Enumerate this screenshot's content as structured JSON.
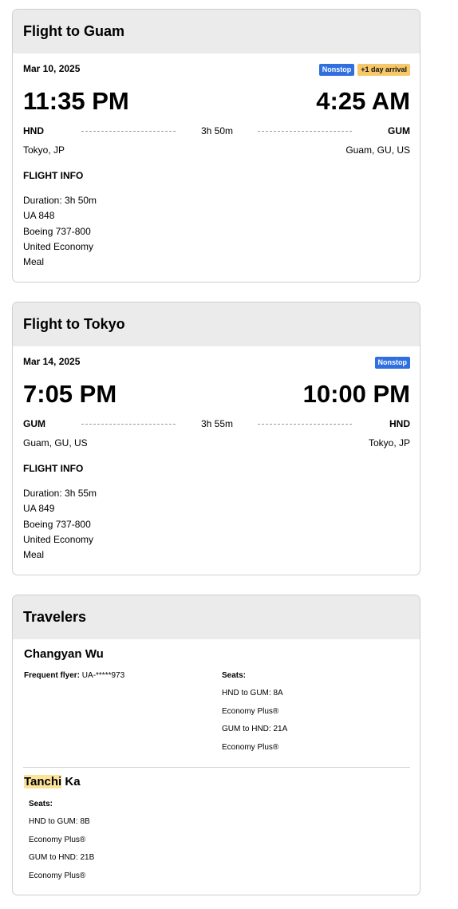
{
  "flights": [
    {
      "title": "Flight to Guam",
      "date": "Mar 10, 2025",
      "badges": [
        "Nonstop",
        "+1 day arrival"
      ],
      "depart_time": "11:35 PM",
      "arrive_time": "4:25 AM",
      "from_code": "HND",
      "to_code": "GUM",
      "duration": "3h 50m",
      "from_city": "Tokyo, JP",
      "to_city": "Guam, GU, US",
      "info_title": "FLIGHT INFO",
      "info": [
        "Duration: 3h 50m",
        "UA 848",
        "Boeing 737-800",
        "United Economy",
        "Meal"
      ]
    },
    {
      "title": "Flight to Tokyo",
      "date": "Mar 14, 2025",
      "badges": [
        "Nonstop"
      ],
      "depart_time": "7:05 PM",
      "arrive_time": "10:00 PM",
      "from_code": "GUM",
      "to_code": "HND",
      "duration": "3h 55m",
      "from_city": "Guam, GU, US",
      "to_city": "Tokyo, JP",
      "info_title": "FLIGHT INFO",
      "info": [
        "Duration: 3h 55m",
        "UA 849",
        "Boeing 737-800",
        "United Economy",
        "Meal"
      ]
    }
  ],
  "travelers": {
    "title": "Travelers",
    "people": [
      {
        "name_first": "Changyan",
        "name_last": "Wu",
        "ff_label": "Frequent flyer:",
        "ff_value": "UA-*****973",
        "seats_label": "Seats:",
        "seats": [
          "HND to GUM: 8A",
          "Economy Plus®",
          "GUM to HND: 21A",
          "Economy Plus®"
        ]
      },
      {
        "name_first": "Tanchi",
        "name_last": "Ka",
        "seats_label": "Seats:",
        "seats": [
          "HND to GUM: 8B",
          "Economy Plus®",
          "GUM to HND: 21B",
          "Economy Plus®"
        ]
      }
    ]
  },
  "colors": {
    "header_bg": "#ebebeb",
    "nonstop_badge": "#2f6fe0",
    "arrival_badge": "#f7c86a",
    "name_highlight": "#fde39a"
  }
}
